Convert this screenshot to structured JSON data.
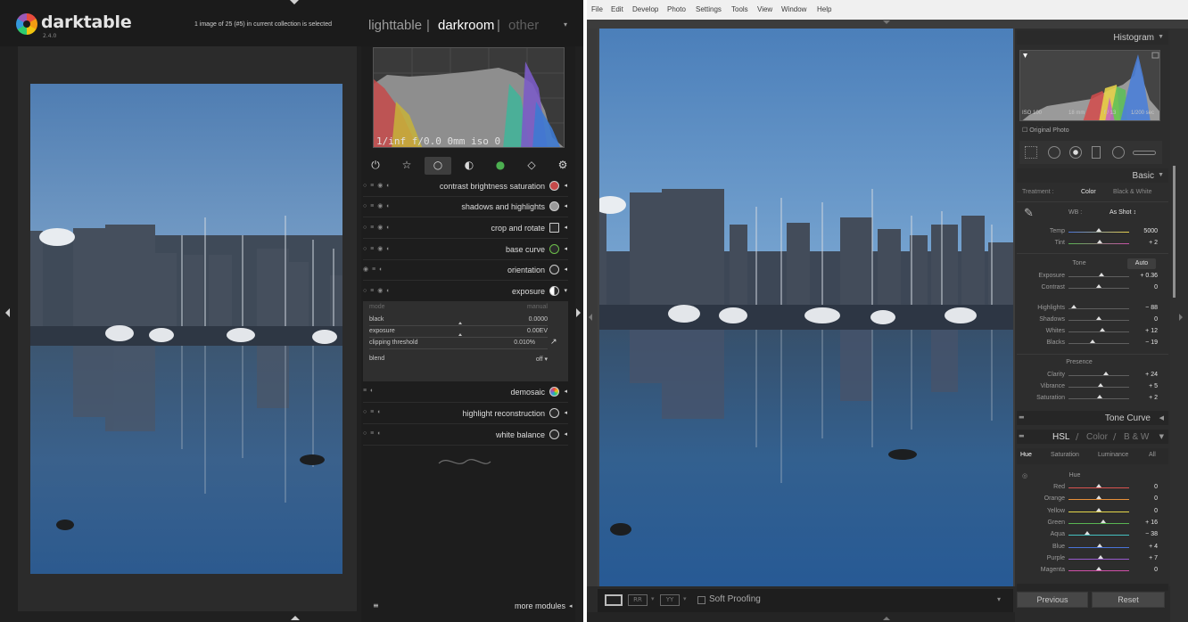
{
  "darktable": {
    "app_name": "darktable",
    "version": "2.4.0",
    "status": "1 image of 25 (#5) in current collection is selected",
    "views": {
      "lighttable": "lighttable",
      "darkroom": "darkroom",
      "other": "other",
      "separator": "|"
    },
    "histogram_label": "1/inf f/0.0 0mm iso 0",
    "module_groups": [
      "power-icon",
      "star-icon",
      "circle-icon",
      "half-circle-icon",
      "color-ball-icon",
      "shape-icon",
      "gear-icon"
    ],
    "modules": [
      {
        "label": "contrast brightness saturation",
        "icon": "palette-icon"
      },
      {
        "label": "shadows and highlights",
        "icon": "sphere-icon"
      },
      {
        "label": "crop and rotate",
        "icon": "crop-icon"
      },
      {
        "label": "base curve",
        "icon": "curve-icon"
      },
      {
        "label": "orientation",
        "icon": "rotate-icon"
      },
      {
        "label": "exposure",
        "icon": "exposure-icon"
      }
    ],
    "exposure_params": {
      "mode_label": "mode",
      "mode_value": "manual",
      "black_label": "black",
      "black_value": "0.0000",
      "exposure_label": "exposure",
      "exposure_value": "0.00EV",
      "clipping_label": "clipping threshold",
      "clipping_value": "0.010%",
      "blend_label": "blend",
      "blend_value": "off"
    },
    "modules_after": [
      {
        "label": "demosaic",
        "icon": "color-wheel-icon"
      },
      {
        "label": "highlight reconstruction",
        "icon": "highlight-icon"
      },
      {
        "label": "white balance",
        "icon": "white-balance-icon"
      }
    ],
    "more_modules": "more modules"
  },
  "lightroom": {
    "menu": [
      "File",
      "Edit",
      "Develop",
      "Photo",
      "Settings",
      "Tools",
      "View",
      "Window",
      "Help"
    ],
    "histogram_title": "Histogram",
    "exif": {
      "iso": "ISO 100",
      "focal": "18 mm",
      "aperture": "f / 13",
      "shutter": "1/200 sec"
    },
    "original_photo": "Original Photo",
    "basic_title": "Basic",
    "treatment_label": "Treatment :",
    "treatment_color": "Color",
    "treatment_bw": "Black & White",
    "wb_label": "WB :",
    "wb_value": "As Shot ↕",
    "temp": {
      "label": "Temp",
      "value": "5000"
    },
    "tint": {
      "label": "Tint",
      "value": "+ 2"
    },
    "tone_label": "Tone",
    "auto_label": "Auto",
    "tone_sliders": [
      {
        "label": "Exposure",
        "value": "+ 0.36"
      },
      {
        "label": "Contrast",
        "value": "0"
      }
    ],
    "range_sliders": [
      {
        "label": "Highlights",
        "value": "− 88"
      },
      {
        "label": "Shadows",
        "value": "0"
      },
      {
        "label": "Whites",
        "value": "+ 12"
      },
      {
        "label": "Blacks",
        "value": "− 19"
      }
    ],
    "presence_label": "Presence",
    "presence_sliders": [
      {
        "label": "Clarity",
        "value": "+ 24"
      },
      {
        "label": "Vibrance",
        "value": "+ 5"
      },
      {
        "label": "Saturation",
        "value": "+ 2"
      }
    ],
    "tone_curve_title": "Tone Curve",
    "hsl": {
      "hsl": "HSL",
      "sep": "/",
      "color": "Color",
      "bw": "B & W"
    },
    "hsl_tabs": {
      "hue": "Hue",
      "saturation": "Saturation",
      "luminance": "Luminance",
      "all": "All"
    },
    "hue_section": "Hue",
    "hue_sliders": [
      {
        "label": "Red",
        "value": "0",
        "color": "#d9534f"
      },
      {
        "label": "Orange",
        "value": "0",
        "color": "#e8913a"
      },
      {
        "label": "Yellow",
        "value": "0",
        "color": "#e6d84a"
      },
      {
        "label": "Green",
        "value": "+ 16",
        "color": "#59b552"
      },
      {
        "label": "Aqua",
        "value": "− 38",
        "color": "#45c0c0"
      },
      {
        "label": "Blue",
        "value": "+ 4",
        "color": "#4a74d9"
      },
      {
        "label": "Purple",
        "value": "+ 7",
        "color": "#9a5bd0"
      },
      {
        "label": "Magenta",
        "value": "0",
        "color": "#d04fa8"
      }
    ],
    "soft_proofing": "Soft Proofing",
    "previous": "Previous",
    "reset": "Reset"
  }
}
